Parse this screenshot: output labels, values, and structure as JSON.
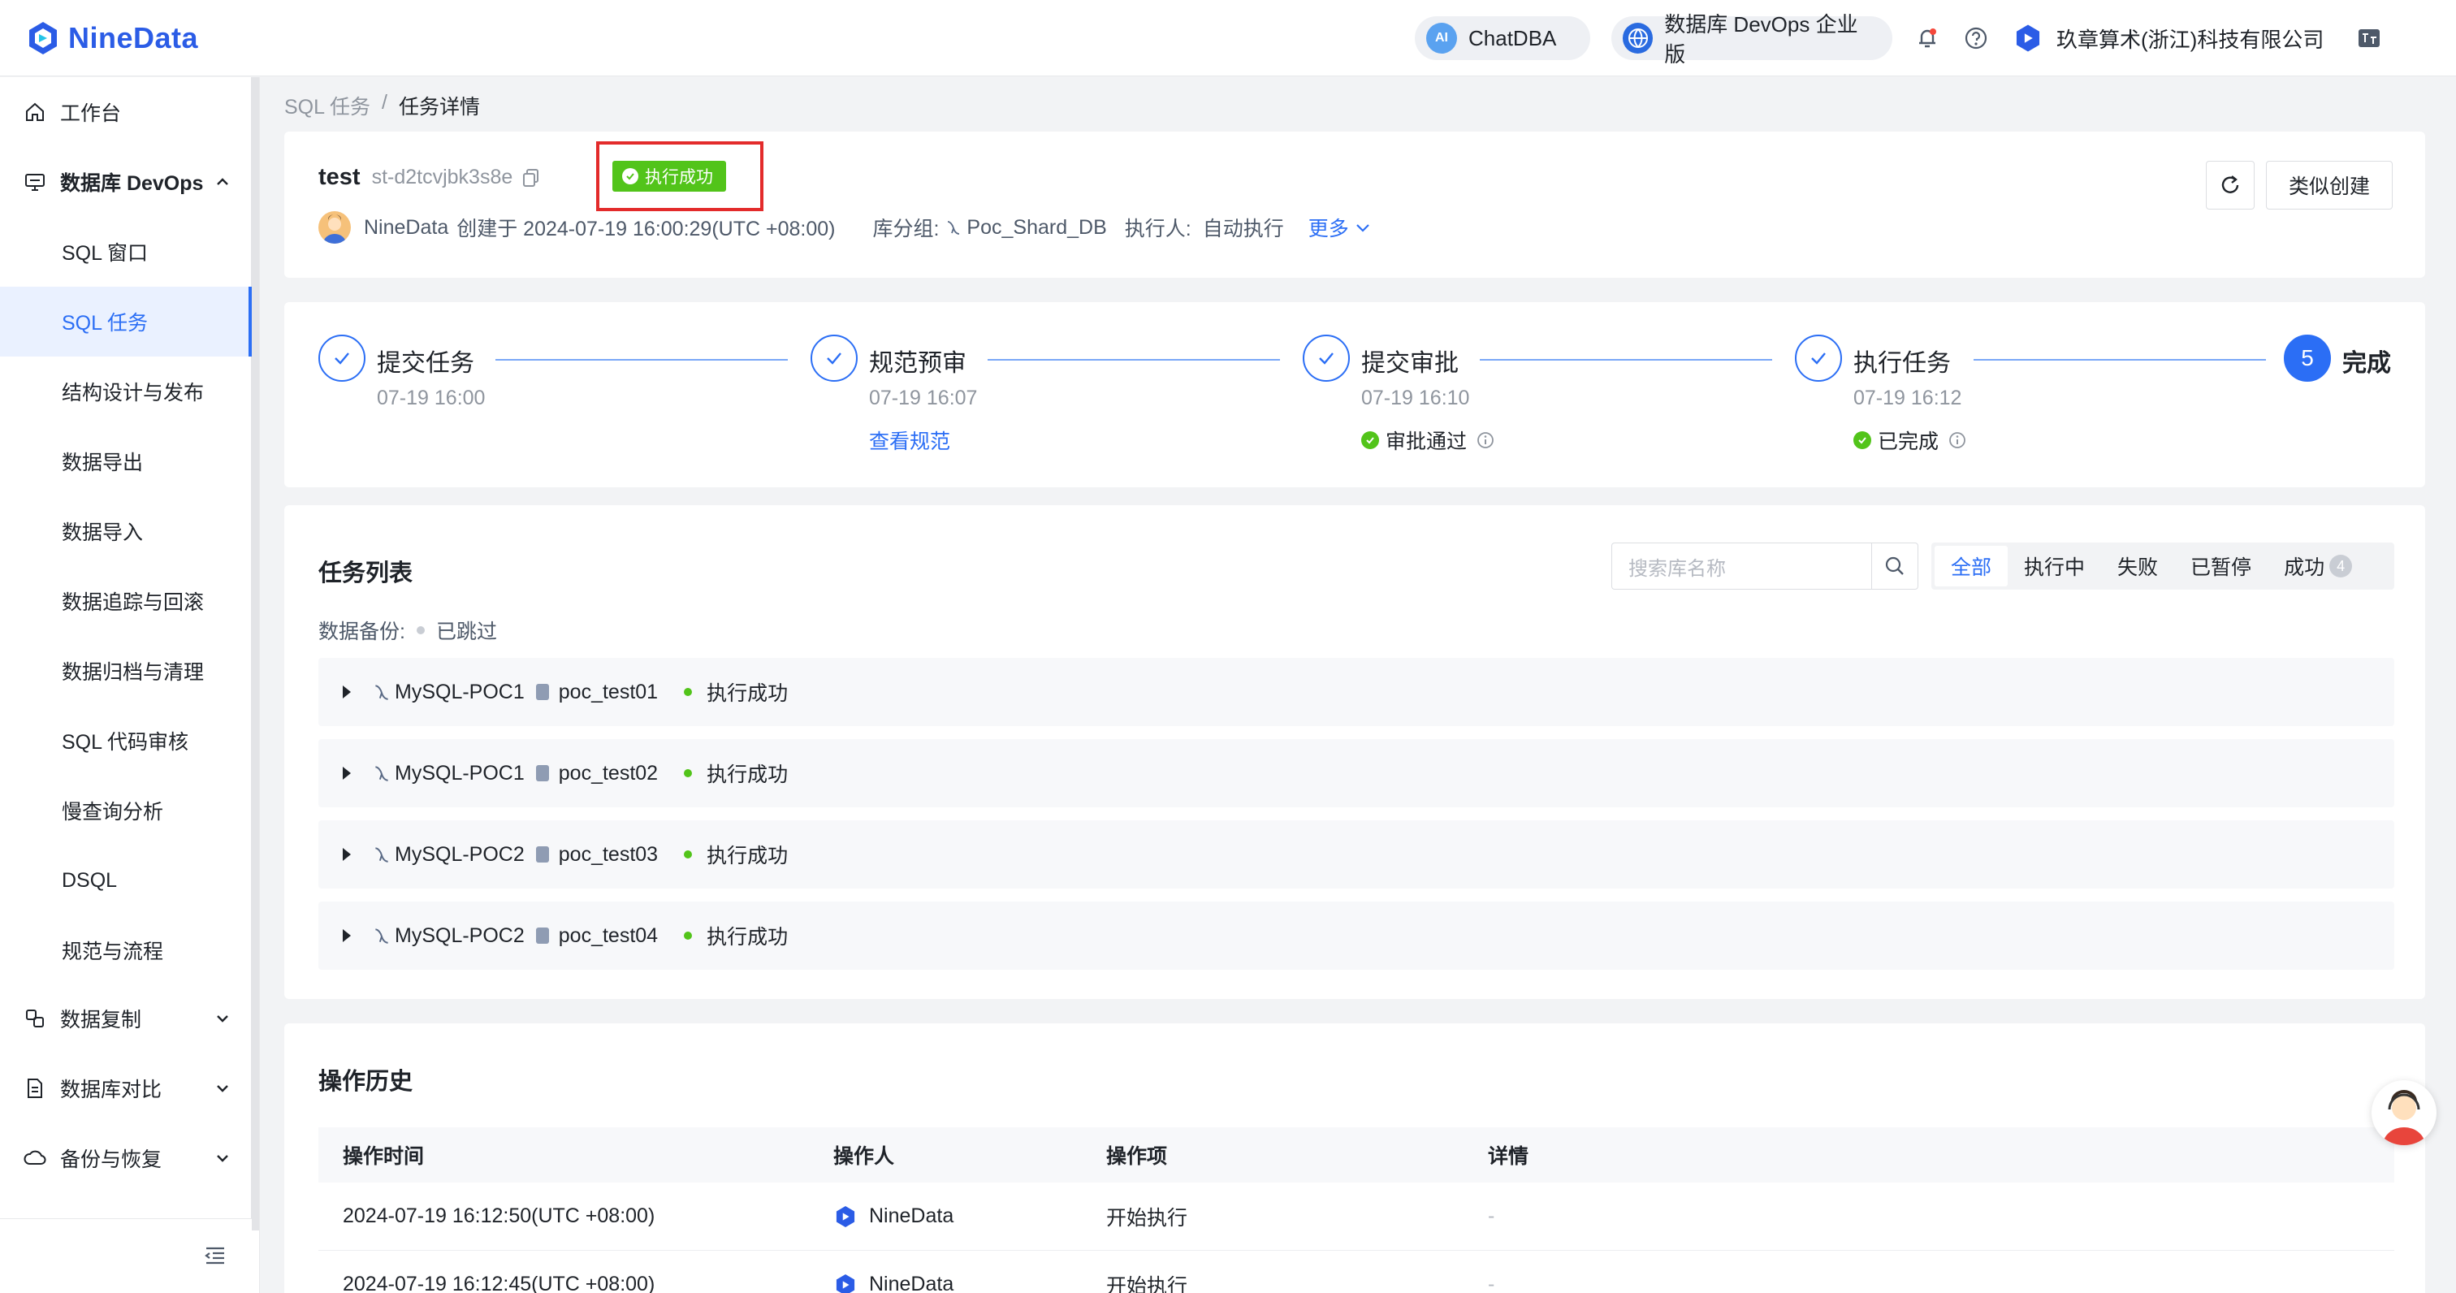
{
  "header": {
    "logo_text": "NineData",
    "chatdba_label": "ChatDBA",
    "chatdba_icon_text": "AI",
    "edition_label": "数据库 DevOps 企业版",
    "company": "玖章算术(浙江)科技有限公司"
  },
  "sidebar": {
    "workbench": "工作台",
    "devops_group": "数据库 DevOps",
    "sub_items": [
      "SQL 窗口",
      "SQL 任务",
      "结构设计与发布",
      "数据导出",
      "数据导入",
      "数据追踪与回滚",
      "数据归档与清理",
      "SQL 代码审核",
      "慢查询分析",
      "DSQL",
      "规范与流程"
    ],
    "groups": [
      "数据复制",
      "数据库对比",
      "备份与恢复"
    ]
  },
  "breadcrumb": {
    "parent": "SQL 任务",
    "sep": "/",
    "current": "任务详情"
  },
  "task": {
    "title": "test",
    "id": "st-d2tcvjbk3s8e",
    "status": "执行成功",
    "creator": "NineData",
    "created_text": "创建于 2024-07-19 16:00:29(UTC +08:00)",
    "group_label": "库分组:",
    "group_value": "Poc_Shard_DB",
    "executor_label": "执行人:",
    "executor_value": "自动执行",
    "more_label": "更多",
    "similar_button": "类似创建"
  },
  "steps": [
    {
      "label": "提交任务",
      "time": "07-19 16:00",
      "extra": ""
    },
    {
      "label": "规范预审",
      "time": "07-19 16:07",
      "extra": "查看规范"
    },
    {
      "label": "提交审批",
      "time": "07-19 16:10",
      "extra": "审批通过"
    },
    {
      "label": "执行任务",
      "time": "07-19 16:12",
      "extra": "已完成"
    },
    {
      "label": "完成",
      "number": "5"
    }
  ],
  "task_list": {
    "title": "任务列表",
    "search_placeholder": "搜索库名称",
    "filters": [
      "全部",
      "执行中",
      "失败",
      "已暂停",
      "成功"
    ],
    "success_count": "4",
    "backup_label": "数据备份:",
    "backup_value": "已跳过",
    "rows": [
      {
        "instance": "MySQL-POC1",
        "db": "poc_test01",
        "status": "执行成功"
      },
      {
        "instance": "MySQL-POC1",
        "db": "poc_test02",
        "status": "执行成功"
      },
      {
        "instance": "MySQL-POC2",
        "db": "poc_test03",
        "status": "执行成功"
      },
      {
        "instance": "MySQL-POC2",
        "db": "poc_test04",
        "status": "执行成功"
      }
    ]
  },
  "history": {
    "title": "操作历史",
    "columns": [
      "操作时间",
      "操作人",
      "操作项",
      "详情"
    ],
    "rows": [
      {
        "time": "2024-07-19 16:12:50(UTC +08:00)",
        "operator": "NineData",
        "action": "开始执行",
        "detail": "-"
      },
      {
        "time": "2024-07-19 16:12:45(UTC +08:00)",
        "operator": "NineData",
        "action": "开始执行",
        "detail": "-"
      }
    ]
  },
  "colors": {
    "primary": "#2b6ef5",
    "success": "#52c41a",
    "highlight": "#e32b2b"
  }
}
